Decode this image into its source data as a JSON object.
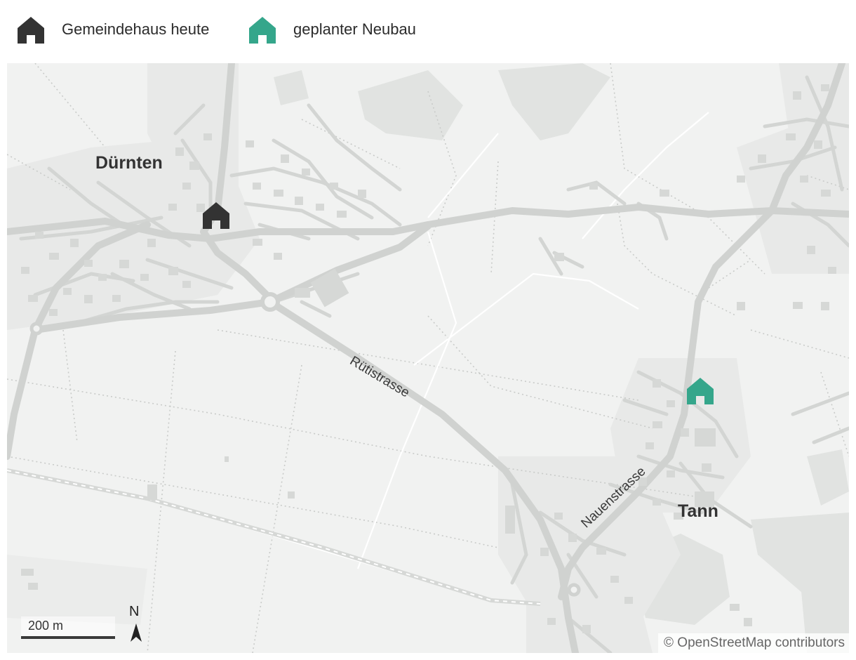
{
  "legend": {
    "current": {
      "label": "Gemeindehaus heute",
      "color": "#333333",
      "icon": "house-icon"
    },
    "planned": {
      "label": "geplanter Neubau",
      "color": "#35a68b",
      "icon": "house-icon"
    }
  },
  "map": {
    "places": {
      "duernten": "Dürnten",
      "tann": "Tann"
    },
    "streets": {
      "ruetistrasse": "Rütistrasse",
      "nauenstrasse": "Nauenstrasse"
    },
    "scale": {
      "label": "200 m"
    },
    "north": {
      "label": "N",
      "icon": "north-arrow-icon"
    },
    "attribution": "© OpenStreetMap contributors"
  }
}
